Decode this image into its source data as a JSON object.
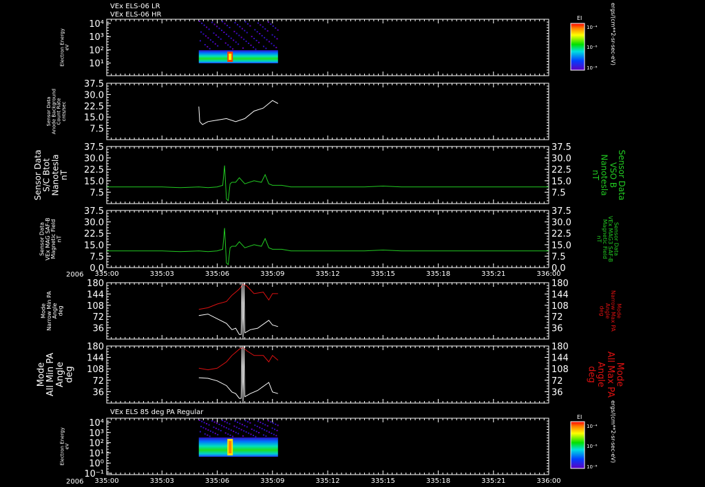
{
  "colors": {
    "white": "#ffffff",
    "green": "#22cc22",
    "red": "#dd1111",
    "background": "#000000"
  },
  "header": {
    "line1": "VEx ELS-06 LR",
    "line2": "VEx ELS-06 HR"
  },
  "mid_title": "VEx ELS 85 deg PA Regular",
  "colorbar_units": "ergs/(cm**2-sr-sec-eV)",
  "colorbar_title": "EI",
  "colorbar_ticks": [
    "10⁻⁴",
    "10⁻⁶",
    "10⁻⁸"
  ],
  "x_axis": {
    "year": "2006",
    "ticks": [
      "335:00",
      "335:03",
      "335:06",
      "335:09",
      "335:12",
      "335:15",
      "335:18",
      "335:21",
      "336:00"
    ]
  },
  "chart_data": [
    {
      "type": "heatmap",
      "ylabel": [
        "Electron Energy",
        "eV"
      ],
      "yticks": [
        "10⁴",
        "10³",
        "10²",
        "10¹"
      ],
      "colorbar": {
        "title": "EI",
        "units": "ergs/(cm**2-sr-sec-eV)",
        "ticks": [
          "10⁻⁴",
          "10⁻⁶",
          "10⁻⁸"
        ]
      },
      "data_extent_hours": [
        5.0,
        9.3
      ]
    },
    {
      "type": "line",
      "ylabel": [
        "Sensor Data",
        "Anode Background",
        "Count Rate",
        "cnts/sec"
      ],
      "yticks": [
        "37.5",
        "30.0",
        "22.5",
        "15.0",
        "7.5"
      ],
      "ylim": [
        0,
        37.5
      ],
      "series": [
        {
          "color": "#ffffff",
          "x": [
            5.0,
            5.05,
            5.2,
            5.5,
            6.0,
            6.5,
            7.0,
            7.5,
            8.0,
            8.5,
            9.0,
            9.3
          ],
          "y": [
            22,
            12,
            10,
            12,
            13,
            14,
            12,
            14,
            19,
            21,
            26,
            24
          ]
        }
      ]
    },
    {
      "type": "line",
      "ylabel": [
        "Sensor Data",
        "S/C Btot",
        "Nanotesla",
        "nT"
      ],
      "ylabel_right": [
        "Sensor Data",
        "VSO B",
        "Nanotesla",
        "nT"
      ],
      "yticks": [
        "37.5",
        "30.0",
        "22.5",
        "15.0",
        "7.5"
      ],
      "ylim": [
        0,
        37.5
      ],
      "series": [
        {
          "color": "#22cc22",
          "x": [
            0,
            1,
            2,
            3,
            4,
            5,
            5.5,
            6.0,
            6.3,
            6.4,
            6.5,
            6.6,
            6.7,
            6.8,
            7.0,
            7.2,
            7.5,
            8.0,
            8.4,
            8.6,
            8.8,
            9.0,
            9.5,
            10,
            12,
            14,
            15,
            16,
            18,
            20,
            22,
            24
          ],
          "y": [
            11,
            11,
            11,
            11,
            10.5,
            11,
            10.5,
            11,
            12,
            25,
            3,
            2,
            13,
            14,
            14,
            17,
            13,
            15,
            14,
            19,
            13,
            12,
            12,
            11,
            11,
            11,
            11.5,
            11,
            11,
            11,
            11,
            11
          ]
        }
      ]
    },
    {
      "type": "line",
      "ylabel": [
        "Sensor Data",
        "VEx MAG SAF-B",
        "Magnetic Field",
        "nT"
      ],
      "ylabel_right": [
        "Sensor Data",
        "VEx MAG3 SAF-B",
        "Magnetic Field",
        "nT"
      ],
      "yticks": [
        "37.5",
        "30.0",
        "22.5",
        "15.0",
        "7.5",
        "0.0"
      ],
      "ylim": [
        0,
        37.5
      ],
      "series": [
        {
          "color": "#22cc22",
          "x": [
            0,
            1,
            2,
            3,
            4,
            5,
            5.5,
            6.0,
            6.3,
            6.4,
            6.5,
            6.6,
            6.7,
            6.8,
            7.0,
            7.2,
            7.5,
            8.0,
            8.4,
            8.6,
            8.8,
            9.0,
            9.5,
            10,
            12,
            14,
            15,
            16,
            18,
            20,
            22,
            24
          ],
          "y": [
            11,
            11,
            11,
            11,
            10.5,
            11,
            10.5,
            11,
            12,
            26,
            3,
            2,
            13,
            14,
            14,
            17,
            13,
            15,
            14,
            19,
            13,
            12,
            12,
            11,
            11,
            11,
            11.5,
            11,
            11,
            11,
            11,
            11
          ]
        }
      ]
    },
    {
      "type": "line",
      "ylabel": [
        "Mode",
        "Narrow Min PA",
        "Angle",
        "deg"
      ],
      "ylabel_right": [
        "Mode",
        "Narrow Max PA",
        "Angle",
        "deg"
      ],
      "yticks": [
        "180",
        "144",
        "108",
        "72",
        "36"
      ],
      "ylim": [
        0,
        180
      ],
      "series": [
        {
          "color": "#dd1111",
          "x": [
            5.0,
            5.5,
            6.0,
            6.5,
            6.8,
            7.0,
            7.2,
            7.4,
            7.6,
            8.0,
            8.5,
            8.8,
            9.0,
            9.3
          ],
          "y": [
            95,
            100,
            112,
            120,
            140,
            150,
            160,
            175,
            170,
            145,
            150,
            125,
            145,
            145
          ]
        },
        {
          "color": "#ffffff",
          "x": [
            5.0,
            5.5,
            6.0,
            6.5,
            6.8,
            7.0,
            7.2,
            7.3,
            7.35,
            7.4,
            7.45,
            7.5,
            7.8,
            8.2,
            8.8,
            9.0,
            9.3
          ],
          "y": [
            75,
            80,
            65,
            50,
            30,
            35,
            15,
            15,
            180,
            0,
            180,
            20,
            30,
            35,
            60,
            45,
            40
          ]
        }
      ]
    },
    {
      "type": "line",
      "ylabel": [
        "Mode",
        "All Min PA",
        "Angle",
        "deg"
      ],
      "ylabel_right": [
        "Mode",
        "All Max PA",
        "Angle",
        "deg"
      ],
      "yticks": [
        "180",
        "144",
        "108",
        "72",
        "36"
      ],
      "ylim": [
        0,
        180
      ],
      "series": [
        {
          "color": "#dd1111",
          "x": [
            5.0,
            5.5,
            6.0,
            6.5,
            6.8,
            7.0,
            7.2,
            7.4,
            7.6,
            8.0,
            8.5,
            8.8,
            9.0,
            9.3
          ],
          "y": [
            110,
            105,
            110,
            130,
            150,
            160,
            170,
            175,
            165,
            150,
            150,
            130,
            150,
            135
          ]
        },
        {
          "color": "#ffffff",
          "x": [
            5.0,
            5.5,
            6.0,
            6.5,
            6.8,
            7.0,
            7.2,
            7.3,
            7.35,
            7.4,
            7.45,
            7.5,
            7.8,
            8.2,
            8.8,
            9.0,
            9.3
          ],
          "y": [
            80,
            78,
            70,
            55,
            35,
            30,
            15,
            15,
            180,
            0,
            180,
            20,
            30,
            40,
            65,
            35,
            30
          ]
        }
      ]
    },
    {
      "type": "heatmap",
      "ylabel": [
        "Electron Energy",
        "eV"
      ],
      "yticks": [
        "10⁴",
        "10³",
        "10²",
        "10¹",
        "10⁰",
        "10⁻¹"
      ],
      "colorbar": {
        "title": "EI",
        "units": "ergs/(cm**2-sr-sec-eV)",
        "ticks": [
          "10⁻⁴",
          "10⁻⁶",
          "10⁻⁸"
        ]
      },
      "data_extent_hours": [
        5.0,
        9.3
      ]
    }
  ]
}
